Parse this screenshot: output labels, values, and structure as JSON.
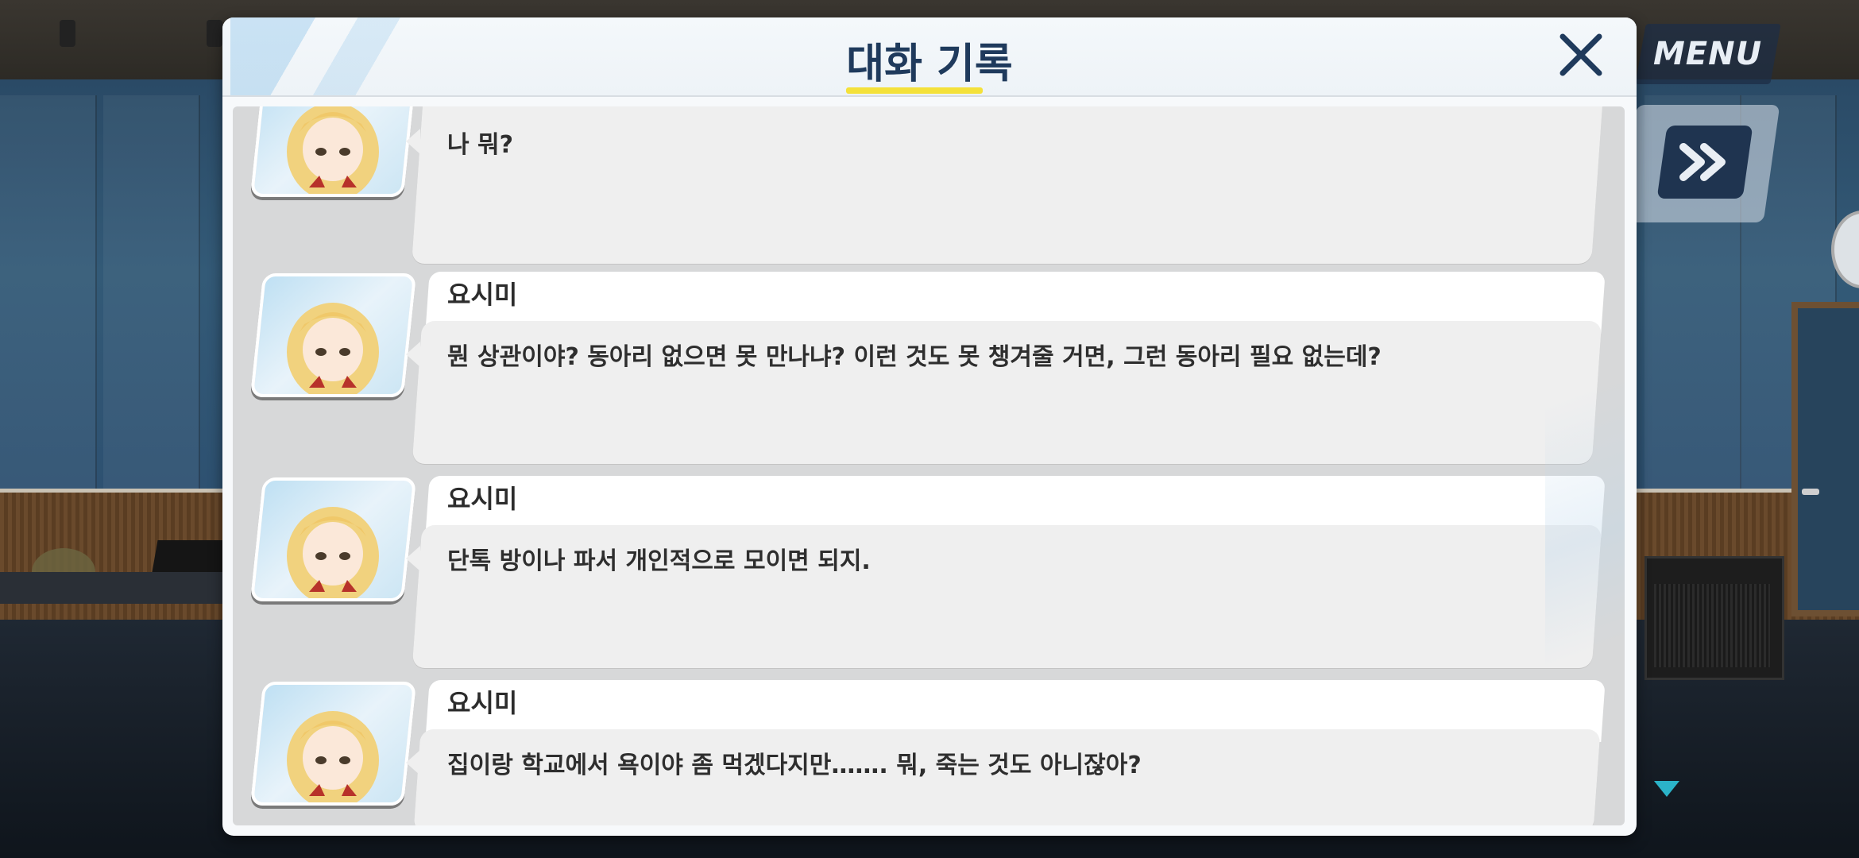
{
  "header": {
    "title": "대화 기록"
  },
  "hud": {
    "menu_label": "MENU"
  },
  "icons": {
    "close": "close-icon",
    "fast_forward": "fast-forward-icon",
    "scroll_down": "triangle-down-icon"
  },
  "colors": {
    "title": "#1f3a5c",
    "title_underline": "#f4e13a",
    "hud_button": "#1f3450",
    "scroll_indicator": "#2bb3c8"
  },
  "log": [
    {
      "speaker": "",
      "text": "나 뭐?"
    },
    {
      "speaker": "요시미",
      "text": "뭔 상관이야? 동아리 없으면 못 만나냐? 이런 것도 못 챙겨줄 거면, 그런 동아리 필요 없는데?"
    },
    {
      "speaker": "요시미",
      "text": "단톡 방이나 파서 개인적으로 모이면 되지."
    },
    {
      "speaker": "요시미",
      "text": "집이랑 학교에서 욕이야 좀 먹겠다지만……. 뭐, 죽는 것도 아니잖아?"
    }
  ]
}
